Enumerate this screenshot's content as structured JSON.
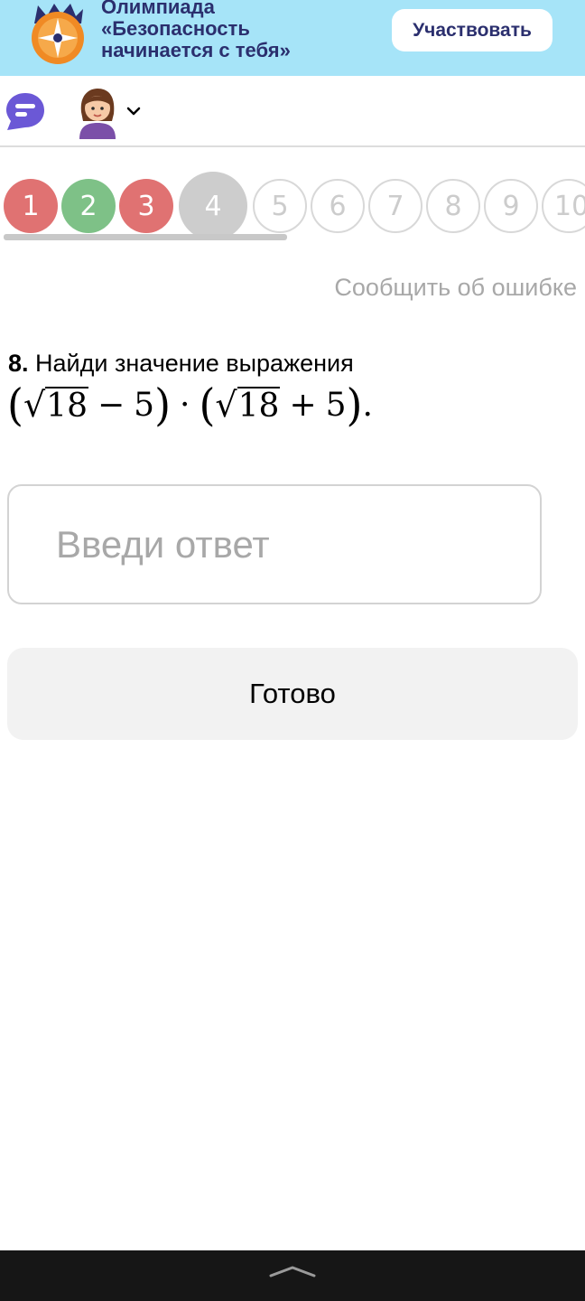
{
  "banner": {
    "title_lines": [
      "Олимпиада",
      "«Безопасность",
      "начинается с тебя»"
    ],
    "cta_label": "Участвовать",
    "logo_icon": "compass-emblem-icon",
    "background": "#a6e4f8"
  },
  "header": {
    "chat_icon": "chat-bubble-icon",
    "avatar_icon": "girl-avatar-icon",
    "menu_icon": "chevron-down-icon"
  },
  "steps": [
    {
      "label": "1",
      "state": "wrong"
    },
    {
      "label": "2",
      "state": "right"
    },
    {
      "label": "3",
      "state": "wrong"
    },
    {
      "label": "4",
      "state": "current"
    },
    {
      "label": "5",
      "state": "todo"
    },
    {
      "label": "6",
      "state": "todo"
    },
    {
      "label": "7",
      "state": "todo"
    },
    {
      "label": "8",
      "state": "todo"
    },
    {
      "label": "9",
      "state": "todo"
    },
    {
      "label": "10",
      "state": "todo"
    }
  ],
  "report_label": "Сообщить об ошибке",
  "question": {
    "number": "8.",
    "text": "Найди значение выражения",
    "formula": {
      "radicand": "18",
      "op1": "−",
      "num": "5",
      "dot": "·",
      "op2": "+",
      "end": "."
    }
  },
  "answer": {
    "placeholder": "Введи ответ",
    "value": ""
  },
  "submit_label": "Готово",
  "colors": {
    "wrong": "#e07272",
    "right": "#7ec187",
    "current": "#cdcdcd",
    "banner_text": "#2b2f6e"
  },
  "system_nav": {
    "icon": "swipe-up-handle-icon"
  }
}
